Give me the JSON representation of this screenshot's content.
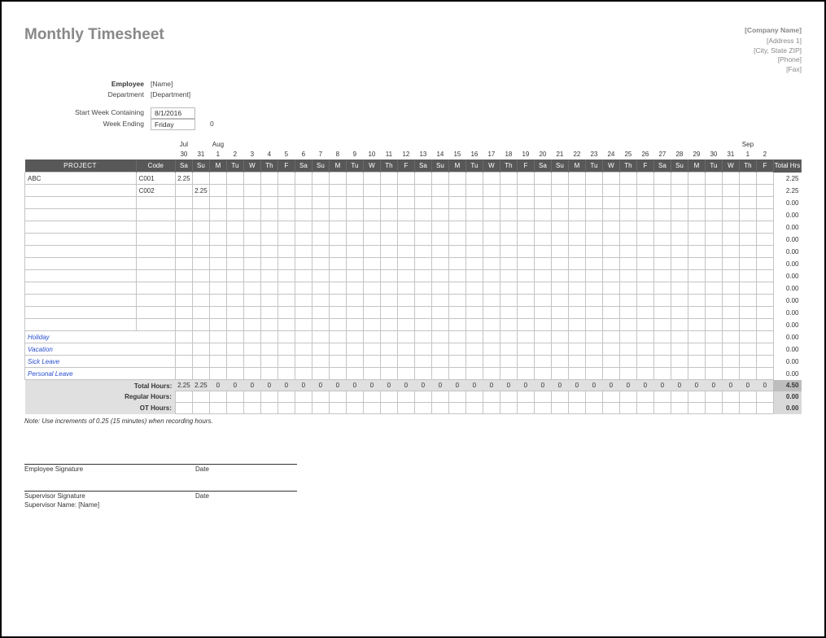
{
  "header": {
    "title": "Monthly Timesheet",
    "company_name": "[Company Name]",
    "address1": "[Address 1]",
    "city_state_zip": "[City, State ZIP]",
    "phone": "[Phone]",
    "fax": "[Fax]"
  },
  "info": {
    "employee_label": "Employee",
    "employee_value": "[Name]",
    "department_label": "Department",
    "department_value": "[Department]",
    "start_week_label": "Start Week Containing",
    "start_week_value": "8/1/2016",
    "week_ending_label": "Week Ending",
    "week_ending_value": "Friday",
    "week_ending_extra": "0"
  },
  "columns": {
    "project": "PROJECT",
    "code": "Code",
    "total_hrs": "Total Hrs"
  },
  "months": {
    "jul": "Jul",
    "aug": "Aug",
    "sep": "Sep"
  },
  "dates": [
    "30",
    "31",
    "1",
    "2",
    "3",
    "4",
    "5",
    "6",
    "7",
    "8",
    "9",
    "10",
    "11",
    "12",
    "13",
    "14",
    "15",
    "16",
    "17",
    "18",
    "19",
    "20",
    "21",
    "22",
    "23",
    "24",
    "25",
    "26",
    "27",
    "28",
    "29",
    "30",
    "31",
    "1",
    "2"
  ],
  "dows": [
    "Sa",
    "Su",
    "M",
    "Tu",
    "W",
    "Th",
    "F",
    "Sa",
    "Su",
    "M",
    "Tu",
    "W",
    "Th",
    "F",
    "Sa",
    "Su",
    "M",
    "Tu",
    "W",
    "Th",
    "F",
    "Sa",
    "Su",
    "M",
    "Tu",
    "W",
    "Th",
    "F",
    "Sa",
    "Su",
    "M",
    "Tu",
    "W",
    "Th",
    "F"
  ],
  "rows": [
    {
      "project": "ABC",
      "code": "C001",
      "hours": {
        "0": "2.25"
      },
      "total": "2.25"
    },
    {
      "project": "",
      "code": "C002",
      "hours": {
        "1": "2.25"
      },
      "total": "2.25"
    },
    {
      "project": "",
      "code": "",
      "hours": {},
      "total": "0.00"
    },
    {
      "project": "",
      "code": "",
      "hours": {},
      "total": "0.00"
    },
    {
      "project": "",
      "code": "",
      "hours": {},
      "total": "0.00"
    },
    {
      "project": "",
      "code": "",
      "hours": {},
      "total": "0.00"
    },
    {
      "project": "",
      "code": "",
      "hours": {},
      "total": "0.00"
    },
    {
      "project": "",
      "code": "",
      "hours": {},
      "total": "0.00"
    },
    {
      "project": "",
      "code": "",
      "hours": {},
      "total": "0.00"
    },
    {
      "project": "",
      "code": "",
      "hours": {},
      "total": "0.00"
    },
    {
      "project": "",
      "code": "",
      "hours": {},
      "total": "0.00"
    },
    {
      "project": "",
      "code": "",
      "hours": {},
      "total": "0.00"
    },
    {
      "project": "",
      "code": "",
      "hours": {},
      "total": "0.00"
    }
  ],
  "leave_rows": [
    {
      "project": "Holiday",
      "total": "0.00"
    },
    {
      "project": "Vacation",
      "total": "0.00"
    },
    {
      "project": "Sick Leave",
      "total": "0.00"
    },
    {
      "project": "Personal Leave",
      "total": "0.00"
    }
  ],
  "totals": {
    "total_hours_label": "Total Hours:",
    "total_hours": [
      "2.25",
      "2.25",
      "0",
      "0",
      "0",
      "0",
      "0",
      "0",
      "0",
      "0",
      "0",
      "0",
      "0",
      "0",
      "0",
      "0",
      "0",
      "0",
      "0",
      "0",
      "0",
      "0",
      "0",
      "0",
      "0",
      "0",
      "0",
      "0",
      "0",
      "0",
      "0",
      "0",
      "0",
      "0",
      "0"
    ],
    "total_hours_sum": "4.50",
    "regular_label": "Regular Hours:",
    "regular_sum": "0.00",
    "ot_label": "OT Hours:",
    "ot_sum": "0.00"
  },
  "note": "Note: Use increments of 0.25 (15 minutes) when recording hours.",
  "signatures": {
    "emp_sig": "Employee Signature",
    "date": "Date",
    "sup_sig": "Supervisor Signature",
    "sup_name_label": "Supervisor Name:",
    "sup_name_value": "[Name]"
  }
}
